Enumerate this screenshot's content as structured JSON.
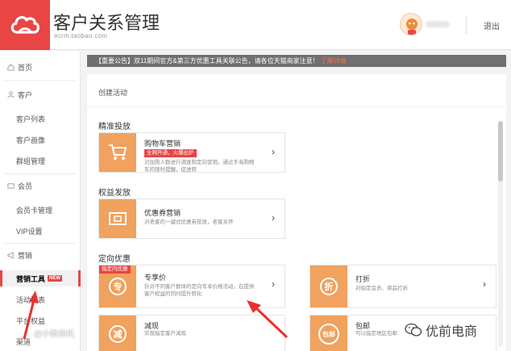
{
  "header": {
    "title": "客户关系管理",
    "subtitle": "ecrm.taobao.com",
    "logout": "退出"
  },
  "sidebar": {
    "items": [
      {
        "label": "首页",
        "icon": "home-icon"
      },
      {
        "label": "客户",
        "icon": "user-icon"
      },
      {
        "label": "客户列表"
      },
      {
        "label": "客户画像"
      },
      {
        "label": "群组管理"
      },
      {
        "label": "会员",
        "icon": "card-icon"
      },
      {
        "label": "会员卡管理"
      },
      {
        "label": "VIP设置"
      },
      {
        "label": "营销",
        "icon": "megaphone-icon"
      },
      {
        "label": "营销工具",
        "badge": "NEW"
      },
      {
        "label": "活动列表"
      },
      {
        "label": "平台权益"
      },
      {
        "label": "渠道"
      }
    ]
  },
  "notice": {
    "text": "【重要公告】双11期间官方&第三方优惠工具关联公告，请各位天猫商家注意！",
    "link": "了解详情"
  },
  "main": {
    "breadcrumb": "创建活动",
    "sections": [
      {
        "title": "精准投放"
      },
      {
        "title": "权益发放"
      },
      {
        "title": "定向优惠"
      }
    ],
    "cards": [
      {
        "title": "购物车营销",
        "badge": "全网开通，火爆出炉",
        "desc": "对加购人群进行调查和定向营销，通过手淘购物车的限时提醒，促进转",
        "icon": "cart-icon"
      },
      {
        "title": "优惠券营销",
        "desc": "对老客的一键式优惠券投放，老客关怀",
        "icon": "coupon-icon"
      },
      {
        "title": "专享价",
        "badge": "指定内优惠",
        "desc": "针对不同客户群体的定向专享价格活动，在提供客户权益的同时提升转化",
        "icon": "exclusive-icon",
        "icon_text": "专"
      },
      {
        "title": "打折",
        "desc": "对指定会员、商品打折",
        "icon": "discount-icon",
        "icon_text": "折"
      },
      {
        "title": "减现",
        "desc": "实现指定客户减现",
        "icon": "cashback-icon",
        "icon_text": "减"
      },
      {
        "title": "包邮",
        "desc": "可以指定地区包邮",
        "icon": "free-shipping-icon",
        "icon_text": "包邮"
      }
    ],
    "arrow": "›"
  },
  "watermarks": {
    "left": "@小微商机",
    "right": "优前电商"
  },
  "colors": {
    "brand": "#e84545",
    "card_icon": "#f0a25e",
    "notice_bg": "#707070"
  }
}
